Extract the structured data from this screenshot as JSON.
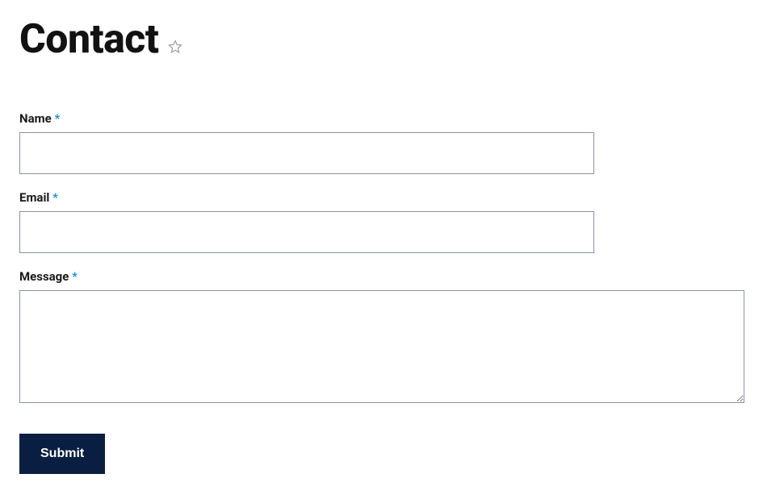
{
  "header": {
    "title": "Contact"
  },
  "form": {
    "fields": {
      "name": {
        "label": "Name",
        "required_marker": "*",
        "value": ""
      },
      "email": {
        "label": "Email",
        "required_marker": "*",
        "value": ""
      },
      "message": {
        "label": "Message",
        "required_marker": "*",
        "value": ""
      }
    },
    "submit_label": "Submit"
  }
}
